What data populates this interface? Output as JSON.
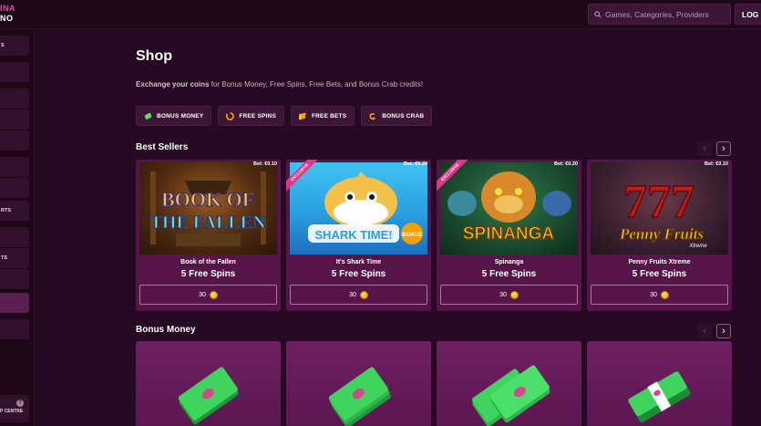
{
  "brand": {
    "line1": "INA",
    "line2": "NO"
  },
  "search": {
    "placeholder": "Games, Categories, Providers"
  },
  "login_label": "LOG I",
  "sidebar": {
    "items": [
      {
        "label": "S",
        "active": false
      },
      {
        "label": "",
        "active": false
      },
      {
        "label": "",
        "active": false
      },
      {
        "label": "",
        "active": false
      },
      {
        "label": "",
        "active": false
      },
      {
        "label": "",
        "active": false
      },
      {
        "label": "",
        "active": false
      },
      {
        "label": "RTS",
        "active": false
      },
      {
        "label": "",
        "active": false
      },
      {
        "label": "TS",
        "active": false
      },
      {
        "label": "",
        "active": false
      },
      {
        "label": "",
        "active": true
      },
      {
        "label": "",
        "active": false
      }
    ],
    "help_label": "P CENTRE"
  },
  "page": {
    "title": "Shop",
    "subtitle_bold": "Exchange your coins",
    "subtitle_rest": " for Bonus Money, Free Spins, Free Bets, and Bonus Crab credits!"
  },
  "tabs": [
    {
      "label": "BONUS MONEY",
      "icon": "bonus-money-icon",
      "color": "#3ccf4e"
    },
    {
      "label": "FREE SPINS",
      "icon": "free-spins-icon",
      "color": "#f0a020"
    },
    {
      "label": "FREE BETS",
      "icon": "free-bets-icon",
      "color": "#f5c518"
    },
    {
      "label": "BONUS CRAB",
      "icon": "bonus-crab-icon",
      "color": "#f0a020"
    }
  ],
  "best_sellers": {
    "title": "Best Sellers",
    "cards": [
      {
        "name": "Book of the Fallen",
        "reward": "5 Free Spins",
        "price": "30",
        "bet": "Bet: €0.10",
        "exclusive": false,
        "art": "BOOK OF\nTHE FALLEN"
      },
      {
        "name": "It's Shark Time",
        "reward": "5 Free Spins",
        "price": "30",
        "bet": "Bet: €0.20",
        "exclusive": true,
        "art": "SHARK TIME"
      },
      {
        "name": "Spinanga",
        "reward": "5 Free Spins",
        "price": "30",
        "bet": "Bet: €0.20",
        "exclusive": true,
        "art": "SPINANGA"
      },
      {
        "name": "Penny Fruits Xtreme",
        "reward": "5 Free Spins",
        "price": "30",
        "bet": "Bet: €0.10",
        "exclusive": false,
        "art": "Penny Fruits"
      }
    ],
    "exclusive_label": "EXCLUSIVE"
  },
  "bonus_money": {
    "title": "Bonus Money"
  }
}
